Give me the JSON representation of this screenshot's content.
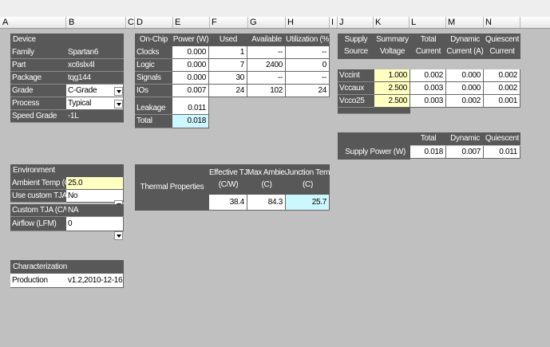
{
  "column_headers": [
    "A",
    "B",
    "C",
    "D",
    "E",
    "F",
    "G",
    "H",
    "I",
    "J",
    "K",
    "L",
    "M",
    "N"
  ],
  "device": {
    "header": "Device",
    "rows": [
      {
        "label": "Family",
        "value": "Spartan6"
      },
      {
        "label": "Part",
        "value": "xc6slx4l"
      },
      {
        "label": "Package",
        "value": "tqg144"
      },
      {
        "label": "Grade",
        "value": "C-Grade"
      },
      {
        "label": "Process",
        "value": "Typical"
      },
      {
        "label": "Speed Grade",
        "value": "-1L"
      }
    ]
  },
  "environment": {
    "header": "Environment",
    "rows": [
      {
        "label": "Ambient Temp (C)",
        "value": "25.0"
      },
      {
        "label": "Use custom TJA?",
        "value": "No"
      },
      {
        "label": "Custom TJA (C/W)",
        "value": "NA"
      },
      {
        "label": "Airflow (LFM)",
        "value": "0"
      }
    ]
  },
  "characterization": {
    "header": "Characterization",
    "label": "Production",
    "value": "v1.2,2010-12-16"
  },
  "onchip": {
    "headers": [
      "On-Chip",
      "Power (W)",
      "Used",
      "Available",
      "Utilization (%)"
    ],
    "rows": [
      {
        "name": "Clocks",
        "power": "0.000",
        "used": "1",
        "available": "--",
        "util": "--"
      },
      {
        "name": "Logic",
        "power": "0.000",
        "used": "7",
        "available": "2400",
        "util": "0"
      },
      {
        "name": "Signals",
        "power": "0.000",
        "used": "30",
        "available": "--",
        "util": "--"
      },
      {
        "name": "IOs",
        "power": "0.007",
        "used": "24",
        "available": "102",
        "util": "24"
      }
    ],
    "leakage": {
      "name": "Leakage",
      "power": "0.011"
    },
    "total": {
      "name": "Total",
      "power": "0.018"
    }
  },
  "thermal": {
    "label": "Thermal  Properties",
    "headers": [
      {
        "line1": "Effective TJA",
        "line2": "(C/W)"
      },
      {
        "line1": "Max Ambient",
        "line2": "(C)"
      },
      {
        "line1": "Junction Temp",
        "line2": "(C)"
      }
    ],
    "values": [
      "38.4",
      "84.3",
      "25.7"
    ]
  },
  "supply_summary": {
    "headers": [
      {
        "line1": "Supply",
        "line2": "Source"
      },
      {
        "line1": "Summary",
        "line2": "Voltage"
      },
      {
        "line1": "Total",
        "line2": "Current (A)"
      },
      {
        "line1": "Dynamic",
        "line2": "Current (A)"
      },
      {
        "line1": "Quiescent",
        "line2": "Current (A)"
      }
    ],
    "rows": [
      {
        "source": "Vccint",
        "voltage": "1.000",
        "total": "0.002",
        "dynamic": "0.000",
        "quiescent": "0.002"
      },
      {
        "source": "Vccaux",
        "voltage": "2.500",
        "total": "0.003",
        "dynamic": "0.000",
        "quiescent": "0.002"
      },
      {
        "source": "Vcco25",
        "voltage": "2.500",
        "total": "0.003",
        "dynamic": "0.002",
        "quiescent": "0.001"
      }
    ]
  },
  "supply_power": {
    "headers": [
      "Total",
      "Dynamic",
      "Quiescent"
    ],
    "label": "Supply  Power (W)",
    "values": [
      "0.018",
      "0.007",
      "0.011"
    ]
  },
  "colors": {
    "header_bg": "#585858",
    "input_yellow": "#ffffc0",
    "result_cyan": "#cdf7ff",
    "sheet_gray": "#c0c0c0"
  }
}
